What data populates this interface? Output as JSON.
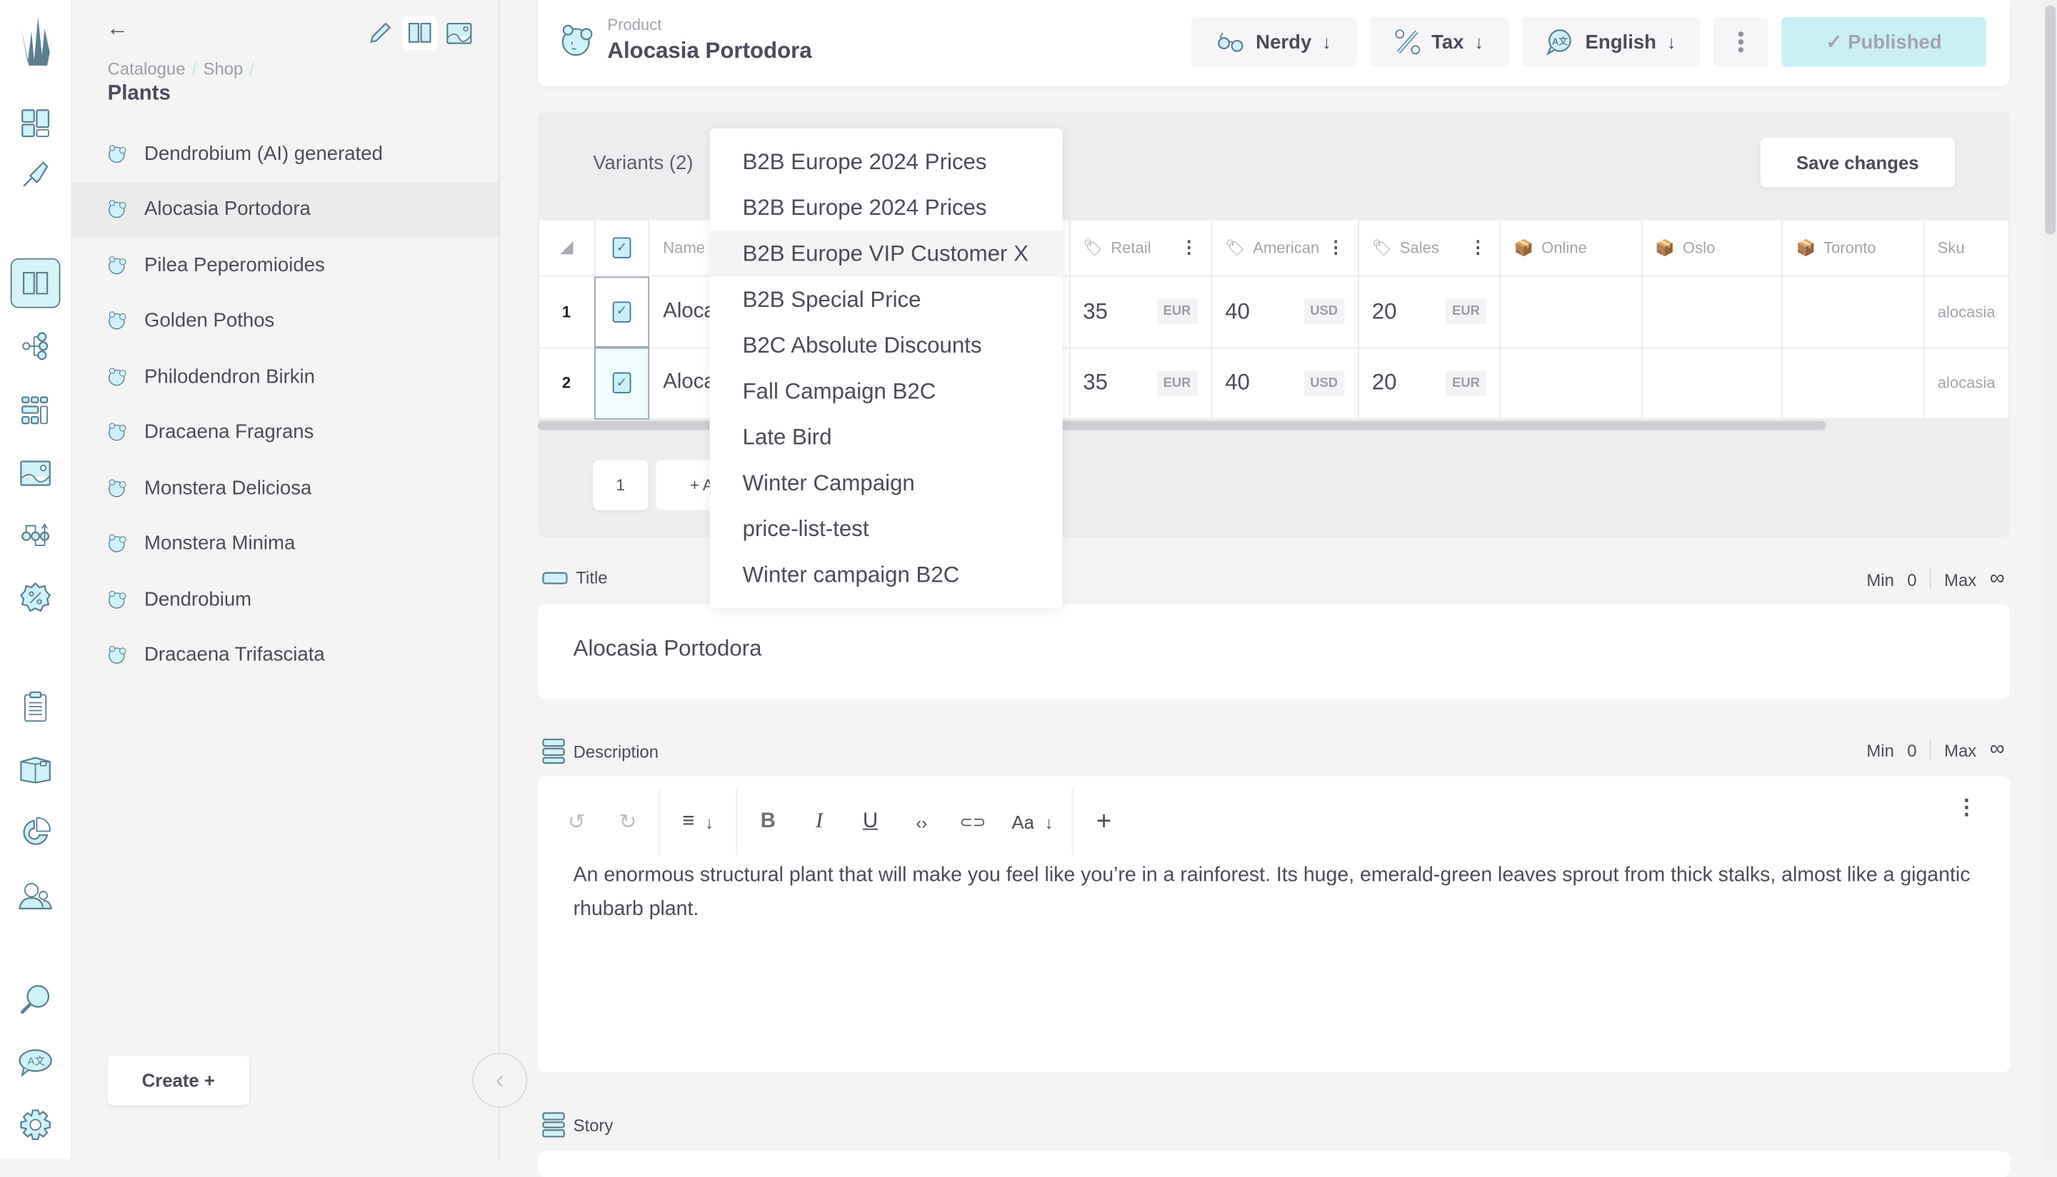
{
  "rail": {
    "items": [
      {
        "name": "dashboard",
        "active": false
      },
      {
        "name": "plugin",
        "active": false
      },
      {
        "name": "catalogue",
        "active": true
      },
      {
        "name": "topics",
        "active": false
      },
      {
        "name": "shapes",
        "active": false
      },
      {
        "name": "media",
        "active": false
      },
      {
        "name": "flows",
        "active": false
      },
      {
        "name": "discounts",
        "active": false
      },
      {
        "name": "orders",
        "active": false
      },
      {
        "name": "stock",
        "active": false
      },
      {
        "name": "reports",
        "active": false
      },
      {
        "name": "customers",
        "active": false
      },
      {
        "name": "search",
        "active": false
      },
      {
        "name": "translations",
        "active": false
      },
      {
        "name": "settings",
        "active": false
      }
    ]
  },
  "tree": {
    "breadcrumb": [
      "Catalogue",
      "Shop"
    ],
    "folder_title": "Plants",
    "items": [
      {
        "label": "Dendrobium (AI) generated",
        "selected": false
      },
      {
        "label": "Alocasia Portodora",
        "selected": true
      },
      {
        "label": "Pilea Peperomioides",
        "selected": false
      },
      {
        "label": "Golden Pothos",
        "selected": false
      },
      {
        "label": "Philodendron Birkin",
        "selected": false
      },
      {
        "label": "Dracaena Fragrans",
        "selected": false
      },
      {
        "label": "Monstera Deliciosa",
        "selected": false
      },
      {
        "label": "Monstera Minima",
        "selected": false
      },
      {
        "label": "Dendrobium",
        "selected": false
      },
      {
        "label": "Dracaena Trifasciata",
        "selected": false
      }
    ],
    "create_label": "Create +"
  },
  "header": {
    "subtitle": "Product",
    "title": "Alocasia Portodora",
    "preferences_label": "Nerdy",
    "tax_label": "Tax",
    "language_label": "English",
    "publish_label": "✓ Published",
    "arrow": "↓"
  },
  "variants": {
    "label": "Variants (2)",
    "save_label": "Save changes",
    "columns": {
      "name": "Name",
      "retail": "Retail",
      "american": "American",
      "sales": "Sales",
      "online": "Online",
      "oslo": "Oslo",
      "toronto": "Toronto",
      "sku": "Sku"
    },
    "rows": [
      {
        "index": "1",
        "checked": true,
        "name": "Alocasia Portodora",
        "retail": "35",
        "retail_cur": "EUR",
        "american": "40",
        "american_cur": "USD",
        "sales": "20",
        "sales_cur": "EUR",
        "online": "",
        "oslo": "",
        "toronto": "",
        "sku": "alocasia"
      },
      {
        "index": "2",
        "checked": true,
        "name": "Alocasia Portodora",
        "retail": "35",
        "retail_cur": "EUR",
        "american": "40",
        "american_cur": "USD",
        "sales": "20",
        "sales_cur": "EUR",
        "online": "",
        "oslo": "",
        "toronto": "",
        "sku": "alocasia"
      }
    ],
    "page": "1",
    "add_label": "+ A"
  },
  "price_list_dropdown": {
    "items": [
      {
        "label": "B2B Europe 2024 Prices",
        "hover": false
      },
      {
        "label": "B2B Europe 2024 Prices",
        "hover": false
      },
      {
        "label": "B2B Europe VIP Customer X",
        "hover": true
      },
      {
        "label": "B2B Special Price",
        "hover": false
      },
      {
        "label": "B2C Absolute Discounts",
        "hover": false
      },
      {
        "label": "Fall Campaign B2C",
        "hover": false
      },
      {
        "label": "Late Bird",
        "hover": false
      },
      {
        "label": "Winter Campaign",
        "hover": false
      },
      {
        "label": "price-list-test",
        "hover": false
      },
      {
        "label": "Winter campaign B2C",
        "hover": false
      }
    ]
  },
  "fields": {
    "title": {
      "label": "Title",
      "min_label": "Min",
      "min": "0",
      "max_label": "Max",
      "max": "∞",
      "value": "Alocasia Portodora"
    },
    "description": {
      "label": "Description",
      "min_label": "Min",
      "min": "0",
      "max_label": "Max",
      "max": "∞",
      "value": "An enormous structural plant that will make you feel like you’re in a rainforest. Its huge, emerald-green leaves sprout from thick stalks, almost like a gigantic rhubarb plant.",
      "toolbar": {
        "undo": "↺",
        "redo": "↻",
        "align": "≡",
        "arrow": "↓",
        "bold": "B",
        "italic": "I",
        "underline": "U",
        "code": "‹›",
        "link": "⊂⊃",
        "text_style": "Aa",
        "insert": "+"
      }
    },
    "story": {
      "label": "Story"
    }
  },
  "colors": {
    "accent": "#cdf2f7",
    "icon_stroke": "#5b7f8f",
    "text": "#4a4c57",
    "muted": "#a3a4ad"
  }
}
